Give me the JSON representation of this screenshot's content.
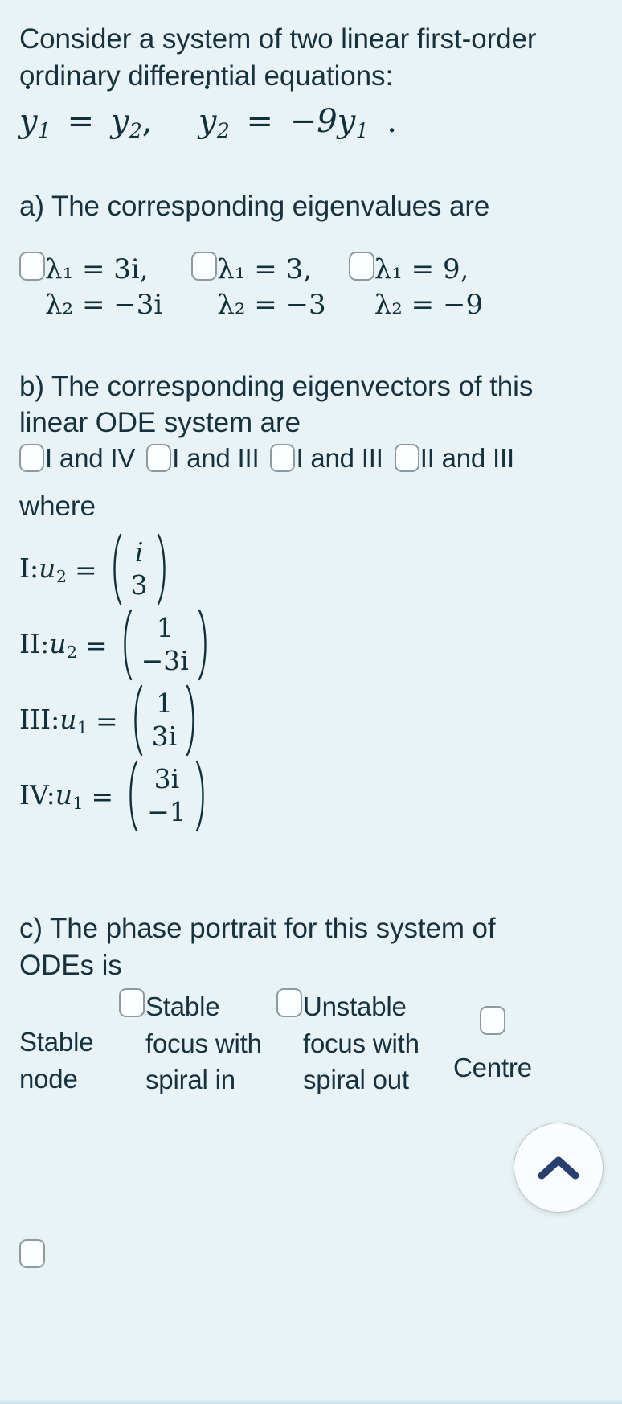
{
  "colors": {
    "background": "#e9f3f5",
    "text": "#17323f",
    "math": "#10303c",
    "checkbox_border": "#8d9aa0",
    "checkbox_fill": "#fbfeff",
    "fab_icon": "#27406e",
    "fab_background": "#fafdfe"
  },
  "intro": {
    "line1": "Consider a system of two linear first-order",
    "line2": "ordinary differential equations:",
    "equation": {
      "lhs1_var": "y",
      "lhs1_sub": "1",
      "rhs1_var": "y",
      "rhs1_sub": "2",
      "comma": ",",
      "lhs2_var": "y",
      "lhs2_sub": "2",
      "rhs2": "−9y",
      "rhs2_sub": "1",
      "period": "."
    }
  },
  "part_a": {
    "prompt": "a) The corresponding eigenvalues are",
    "options": [
      {
        "lambda1": "λ₁ = 3i,",
        "lambda2": "λ₂ = −3i",
        "checked": false
      },
      {
        "lambda1": "λ₁ = 3,",
        "lambda2": "λ₂ = −3",
        "checked": false
      },
      {
        "lambda1": "λ₁ = 9,",
        "lambda2": "λ₂ = −9",
        "checked": false
      }
    ]
  },
  "part_b": {
    "prompt_line1": "b) The corresponding eigenvectors of this",
    "prompt_line2": "linear ODE system are",
    "options": [
      {
        "label": "I and IV",
        "checked": false
      },
      {
        "label": "I and III",
        "checked": false
      },
      {
        "label": "I and III",
        "checked": false
      },
      {
        "label": "II and III",
        "checked": false
      }
    ],
    "where_label": "where",
    "vectors": [
      {
        "name": "I",
        "var": "u",
        "sub": "2",
        "top": "i",
        "bottom": "3"
      },
      {
        "name": "II",
        "var": "u",
        "sub": "2",
        "top": "1",
        "bottom": "−3i"
      },
      {
        "name": "III",
        "var": "u",
        "sub": "1",
        "top": "1",
        "bottom": "3i"
      },
      {
        "name": "IV",
        "var": "u",
        "sub": "1",
        "top": "3i",
        "bottom": "−1"
      }
    ],
    "equals": "="
  },
  "part_c": {
    "prompt_line1": "c) The phase portrait for this system of",
    "prompt_line2": "ODEs is",
    "options": [
      {
        "label": "Stable node",
        "checked": false
      },
      {
        "label": "Stable focus with spiral in",
        "checked": false
      },
      {
        "label": "Unstable focus with spiral out",
        "checked": false
      },
      {
        "label": "Centre",
        "checked": false
      }
    ],
    "option_fragments": {
      "o1_l1": "",
      "o1_l2": "Stable",
      "o1_l3": "node",
      "o2_l1": "Stable",
      "o2_l2": "focus with",
      "o2_l3": "spiral in",
      "o3_l1": "Unstable",
      "o3_l2": "focus with",
      "o3_l3": "spiral out",
      "o4_l1": "",
      "o4_l2": "Centre"
    }
  },
  "scroll_top_button": {
    "icon": "chevron-up-icon",
    "label": ""
  }
}
